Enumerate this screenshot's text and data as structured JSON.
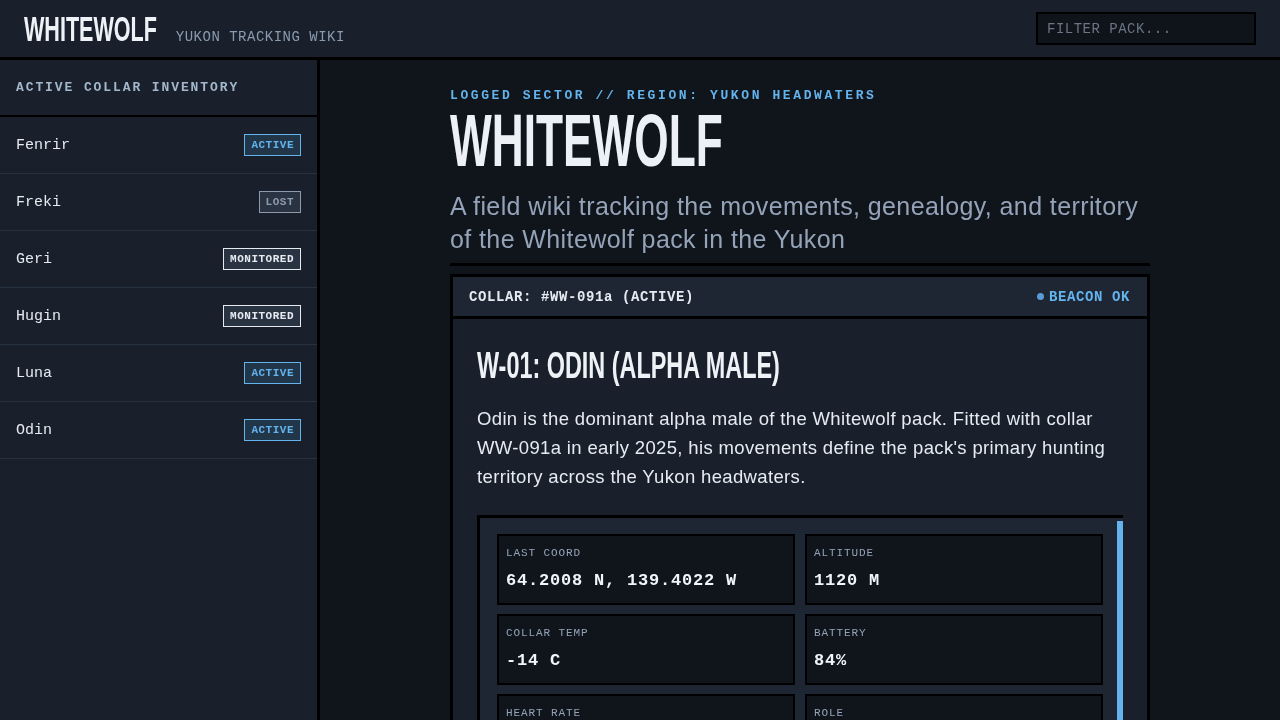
{
  "header": {
    "logo": "WHITEWOLF",
    "subtitle": "YUKON TRACKING WIKI",
    "search": {
      "placeholder": "FILTER PACK..."
    }
  },
  "sidebar": {
    "title": "ACTIVE COLLAR INVENTORY",
    "items": [
      {
        "name": "Fenrir",
        "badge": "ACTIVE",
        "kind": "active"
      },
      {
        "name": "Freki",
        "badge": "LOST",
        "kind": "lost"
      },
      {
        "name": "Geri",
        "badge": "MONITORED",
        "kind": "monitored"
      },
      {
        "name": "Hugin",
        "badge": "MONITORED",
        "kind": "monitored"
      },
      {
        "name": "Luna",
        "badge": "ACTIVE",
        "kind": "active"
      },
      {
        "name": "Odin",
        "badge": "ACTIVE",
        "kind": "active"
      }
    ]
  },
  "page": {
    "kicker": "LOGGED SECTOR // REGION: YUKON HEADWATERS",
    "title": "WHITEWOLF",
    "lead": "A field wiki tracking the movements, genealogy, and territory of the Whitewolf pack in the Yukon"
  },
  "card": {
    "collar": "COLLAR: #WW-091a (ACTIVE)",
    "beacon": "BEACON OK",
    "title": "W-01: ODIN (ALPHA MALE)",
    "description": "Odin is the dominant alpha male of the Whitewolf pack. Fitted with collar WW-091a in early 2025, his movements define the pack's primary hunting territory across the Yukon headwaters.",
    "stats": [
      {
        "label": "LAST COORD",
        "value": "64.2008 N, 139.4022 W"
      },
      {
        "label": "ALTITUDE",
        "value": "1120 M"
      },
      {
        "label": "COLLAR TEMP",
        "value": "-14 C"
      },
      {
        "label": "BATTERY",
        "value": "84%"
      },
      {
        "label": "HEART RATE"
      },
      {
        "label": "ROLE"
      }
    ]
  }
}
